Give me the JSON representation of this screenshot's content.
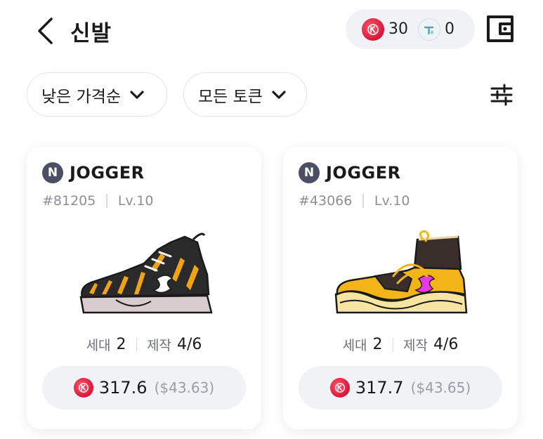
{
  "header": {
    "title": "신발",
    "balances": [
      {
        "icon": "red-token-icon",
        "value": "30"
      },
      {
        "icon": "teal-token-icon",
        "value": "0"
      }
    ]
  },
  "filters": {
    "sort_label": "낮은 가격순",
    "token_label": "모든 토큰"
  },
  "colors": {
    "accent_red": "#e0203f",
    "pill_bg": "#f1f2f6",
    "muted_text": "#8c8f99",
    "badge_bg": "#4a4f63"
  },
  "cards": [
    {
      "type": "JOGGER",
      "badge": "N",
      "id": "#81205",
      "level": "Lv.10",
      "generation_label": "세대",
      "generation": "2",
      "craft_label": "제작",
      "craft": "4/6",
      "price": "317.6",
      "price_usd": "($43.63)",
      "shoe_icon": "tiger-sneaker-icon"
    },
    {
      "type": "JOGGER",
      "badge": "N",
      "id": "#43066",
      "level": "Lv.10",
      "generation_label": "세대",
      "generation": "2",
      "craft_label": "제작",
      "craft": "4/6",
      "price": "317.7",
      "price_usd": "($43.65)",
      "shoe_icon": "yellow-sock-sneaker-icon"
    }
  ]
}
